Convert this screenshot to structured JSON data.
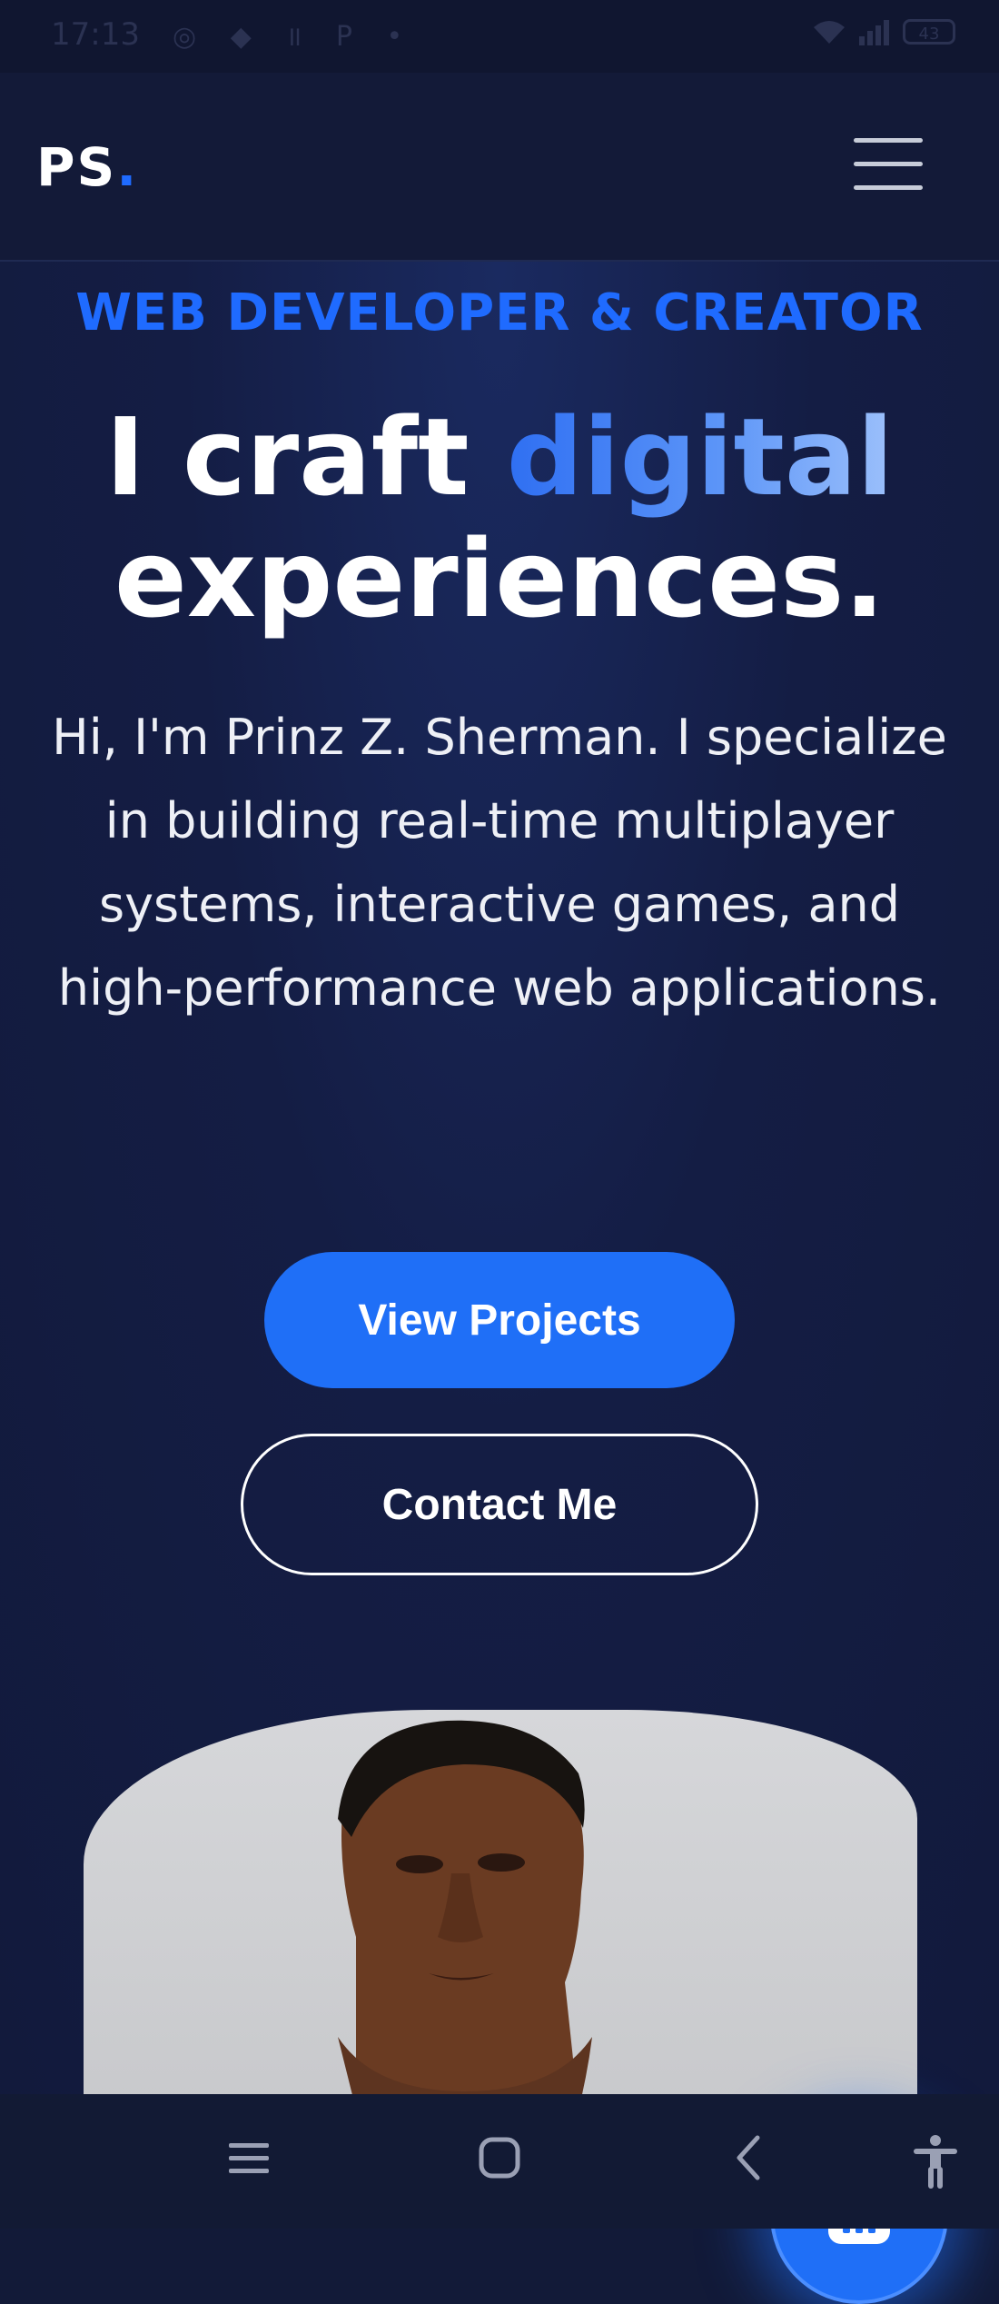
{
  "status_bar": {
    "time": "17:13",
    "left_icons": "◎ ◆ ॥ P •",
    "battery": "43"
  },
  "header": {
    "logo_text": "PS",
    "logo_dot": "."
  },
  "hero": {
    "eyebrow": "WEB DEVELOPER & CREATOR",
    "headline_part1": "I craft ",
    "headline_accent": "digital",
    "headline_part2": "experiences.",
    "intro": "Hi, I'm Prinz Z. Sherman. I specialize in building real-time multiplayer systems, interactive games, and high-performance web applications.",
    "primary_button": "View Projects",
    "secondary_button": "Contact Me"
  },
  "colors": {
    "accent": "#1f6bff",
    "background": "#121a38",
    "text": "#ffffff"
  },
  "icons": {
    "menu": "hamburger-icon",
    "chat": "robot-icon",
    "sys_recents": "recents-icon",
    "sys_home": "home-icon",
    "sys_back": "back-icon",
    "sys_accessibility": "accessibility-icon"
  }
}
